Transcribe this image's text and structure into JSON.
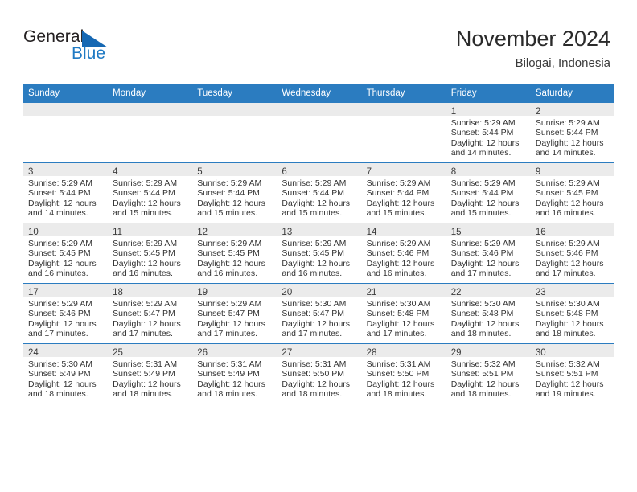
{
  "brand": {
    "name_part1": "General",
    "name_part2": "Blue",
    "accent_color": "#1668b3"
  },
  "header": {
    "title": "November 2024",
    "subtitle": "Bilogai, Indonesia"
  },
  "theme": {
    "header_blue": "#2b7cc0",
    "daynum_band": "#ebebeb"
  },
  "weekdays": [
    "Sunday",
    "Monday",
    "Tuesday",
    "Wednesday",
    "Thursday",
    "Friday",
    "Saturday"
  ],
  "labels": {
    "sunrise_prefix": "Sunrise:",
    "sunset_prefix": "Sunset:",
    "daylight_prefix": "Daylight:"
  },
  "weeks": [
    [
      {
        "day": "",
        "empty": true
      },
      {
        "day": "",
        "empty": true
      },
      {
        "day": "",
        "empty": true
      },
      {
        "day": "",
        "empty": true
      },
      {
        "day": "",
        "empty": true
      },
      {
        "day": "1",
        "sunrise": "Sunrise: 5:29 AM",
        "sunset": "Sunset: 5:44 PM",
        "daylight": "Daylight: 12 hours and 14 minutes."
      },
      {
        "day": "2",
        "sunrise": "Sunrise: 5:29 AM",
        "sunset": "Sunset: 5:44 PM",
        "daylight": "Daylight: 12 hours and 14 minutes."
      }
    ],
    [
      {
        "day": "3",
        "sunrise": "Sunrise: 5:29 AM",
        "sunset": "Sunset: 5:44 PM",
        "daylight": "Daylight: 12 hours and 14 minutes."
      },
      {
        "day": "4",
        "sunrise": "Sunrise: 5:29 AM",
        "sunset": "Sunset: 5:44 PM",
        "daylight": "Daylight: 12 hours and 15 minutes."
      },
      {
        "day": "5",
        "sunrise": "Sunrise: 5:29 AM",
        "sunset": "Sunset: 5:44 PM",
        "daylight": "Daylight: 12 hours and 15 minutes."
      },
      {
        "day": "6",
        "sunrise": "Sunrise: 5:29 AM",
        "sunset": "Sunset: 5:44 PM",
        "daylight": "Daylight: 12 hours and 15 minutes."
      },
      {
        "day": "7",
        "sunrise": "Sunrise: 5:29 AM",
        "sunset": "Sunset: 5:44 PM",
        "daylight": "Daylight: 12 hours and 15 minutes."
      },
      {
        "day": "8",
        "sunrise": "Sunrise: 5:29 AM",
        "sunset": "Sunset: 5:44 PM",
        "daylight": "Daylight: 12 hours and 15 minutes."
      },
      {
        "day": "9",
        "sunrise": "Sunrise: 5:29 AM",
        "sunset": "Sunset: 5:45 PM",
        "daylight": "Daylight: 12 hours and 16 minutes."
      }
    ],
    [
      {
        "day": "10",
        "sunrise": "Sunrise: 5:29 AM",
        "sunset": "Sunset: 5:45 PM",
        "daylight": "Daylight: 12 hours and 16 minutes."
      },
      {
        "day": "11",
        "sunrise": "Sunrise: 5:29 AM",
        "sunset": "Sunset: 5:45 PM",
        "daylight": "Daylight: 12 hours and 16 minutes."
      },
      {
        "day": "12",
        "sunrise": "Sunrise: 5:29 AM",
        "sunset": "Sunset: 5:45 PM",
        "daylight": "Daylight: 12 hours and 16 minutes."
      },
      {
        "day": "13",
        "sunrise": "Sunrise: 5:29 AM",
        "sunset": "Sunset: 5:45 PM",
        "daylight": "Daylight: 12 hours and 16 minutes."
      },
      {
        "day": "14",
        "sunrise": "Sunrise: 5:29 AM",
        "sunset": "Sunset: 5:46 PM",
        "daylight": "Daylight: 12 hours and 16 minutes."
      },
      {
        "day": "15",
        "sunrise": "Sunrise: 5:29 AM",
        "sunset": "Sunset: 5:46 PM",
        "daylight": "Daylight: 12 hours and 17 minutes."
      },
      {
        "day": "16",
        "sunrise": "Sunrise: 5:29 AM",
        "sunset": "Sunset: 5:46 PM",
        "daylight": "Daylight: 12 hours and 17 minutes."
      }
    ],
    [
      {
        "day": "17",
        "sunrise": "Sunrise: 5:29 AM",
        "sunset": "Sunset: 5:46 PM",
        "daylight": "Daylight: 12 hours and 17 minutes."
      },
      {
        "day": "18",
        "sunrise": "Sunrise: 5:29 AM",
        "sunset": "Sunset: 5:47 PM",
        "daylight": "Daylight: 12 hours and 17 minutes."
      },
      {
        "day": "19",
        "sunrise": "Sunrise: 5:29 AM",
        "sunset": "Sunset: 5:47 PM",
        "daylight": "Daylight: 12 hours and 17 minutes."
      },
      {
        "day": "20",
        "sunrise": "Sunrise: 5:30 AM",
        "sunset": "Sunset: 5:47 PM",
        "daylight": "Daylight: 12 hours and 17 minutes."
      },
      {
        "day": "21",
        "sunrise": "Sunrise: 5:30 AM",
        "sunset": "Sunset: 5:48 PM",
        "daylight": "Daylight: 12 hours and 17 minutes."
      },
      {
        "day": "22",
        "sunrise": "Sunrise: 5:30 AM",
        "sunset": "Sunset: 5:48 PM",
        "daylight": "Daylight: 12 hours and 18 minutes."
      },
      {
        "day": "23",
        "sunrise": "Sunrise: 5:30 AM",
        "sunset": "Sunset: 5:48 PM",
        "daylight": "Daylight: 12 hours and 18 minutes."
      }
    ],
    [
      {
        "day": "24",
        "sunrise": "Sunrise: 5:30 AM",
        "sunset": "Sunset: 5:49 PM",
        "daylight": "Daylight: 12 hours and 18 minutes."
      },
      {
        "day": "25",
        "sunrise": "Sunrise: 5:31 AM",
        "sunset": "Sunset: 5:49 PM",
        "daylight": "Daylight: 12 hours and 18 minutes."
      },
      {
        "day": "26",
        "sunrise": "Sunrise: 5:31 AM",
        "sunset": "Sunset: 5:49 PM",
        "daylight": "Daylight: 12 hours and 18 minutes."
      },
      {
        "day": "27",
        "sunrise": "Sunrise: 5:31 AM",
        "sunset": "Sunset: 5:50 PM",
        "daylight": "Daylight: 12 hours and 18 minutes."
      },
      {
        "day": "28",
        "sunrise": "Sunrise: 5:31 AM",
        "sunset": "Sunset: 5:50 PM",
        "daylight": "Daylight: 12 hours and 18 minutes."
      },
      {
        "day": "29",
        "sunrise": "Sunrise: 5:32 AM",
        "sunset": "Sunset: 5:51 PM",
        "daylight": "Daylight: 12 hours and 18 minutes."
      },
      {
        "day": "30",
        "sunrise": "Sunrise: 5:32 AM",
        "sunset": "Sunset: 5:51 PM",
        "daylight": "Daylight: 12 hours and 19 minutes."
      }
    ]
  ]
}
